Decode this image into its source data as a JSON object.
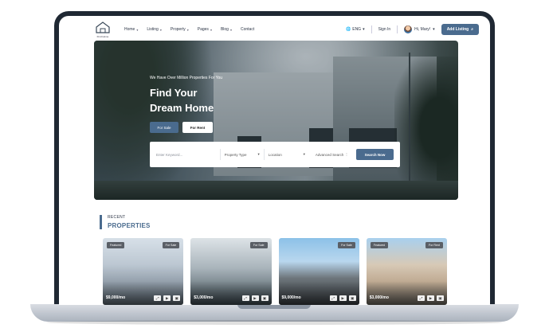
{
  "header": {
    "logo_text": "Find Home",
    "nav": [
      {
        "label": "Home"
      },
      {
        "label": "Listing"
      },
      {
        "label": "Property"
      },
      {
        "label": "Pages"
      },
      {
        "label": "Blog"
      },
      {
        "label": "Contact"
      }
    ],
    "language": "ENG",
    "sign_in": "Sign In",
    "user_greeting": "Hi, Mary!",
    "add_listing": "Add Listing"
  },
  "hero": {
    "kicker": "We Have Over Million Properties For You",
    "title_line1": "Find Your",
    "title_line2": "Dream Home",
    "tab_sale": "For Sale",
    "tab_rent": "For Rent",
    "search": {
      "placeholder": "Enter Keyword...",
      "property_type": "Property Type",
      "location": "Location",
      "advanced": "Advanced Search",
      "button": "Search Now"
    }
  },
  "recent": {
    "label": "RECENT",
    "title": "PROPERTIES",
    "cards": [
      {
        "featured": "Featured",
        "type": "For Sale",
        "price": "$9,000/mo"
      },
      {
        "featured": "",
        "type": "For Sale",
        "price": "$3,000/mo"
      },
      {
        "featured": "",
        "type": "For Sale",
        "price": "$9,000/mo"
      },
      {
        "featured": "Featured",
        "type": "For Rent",
        "price": "$3,000/mo"
      }
    ]
  },
  "colors": {
    "accent": "#4a6b8e",
    "frame": "#1f2833"
  }
}
